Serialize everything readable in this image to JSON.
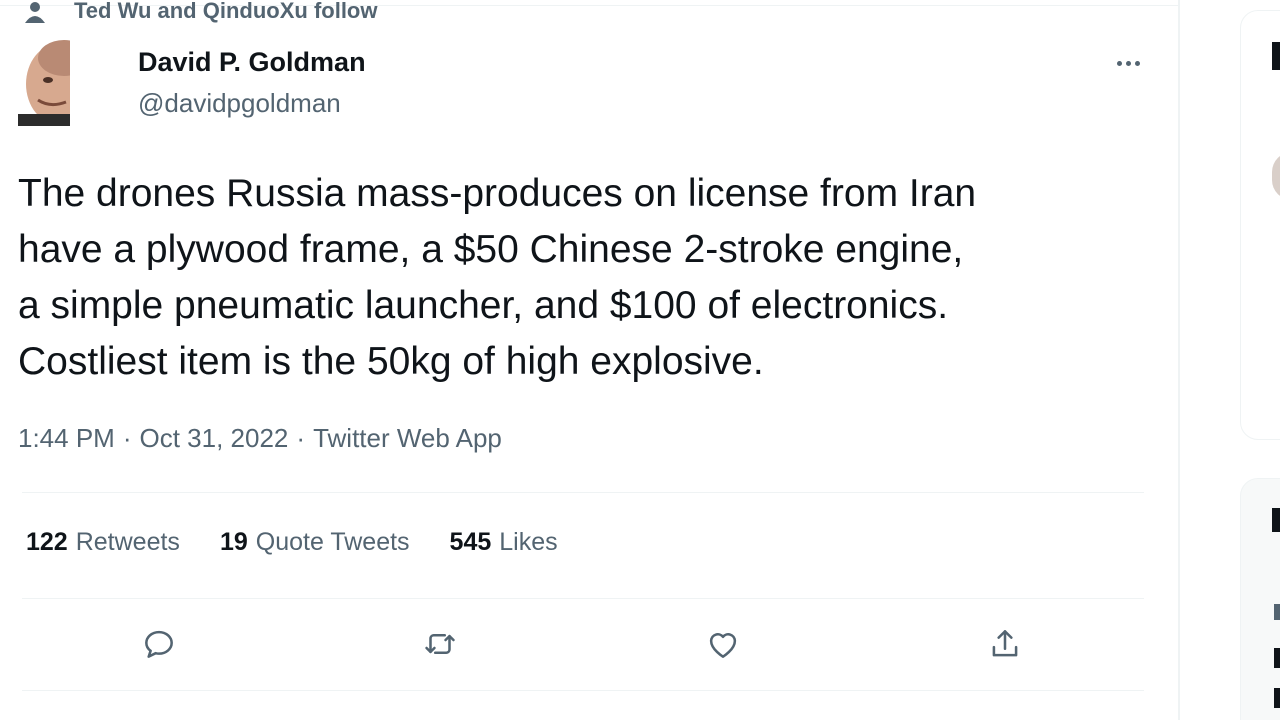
{
  "context": {
    "text": "Ted Wu and QinduoXu follow",
    "icon": "person-icon"
  },
  "author": {
    "name": "David P. Goldman",
    "handle": "@davidpgoldman"
  },
  "tweet": {
    "lines": [
      "The drones Russia mass-produces on license from Iran",
      "have a plywood frame, a $50 Chinese 2-stroke engine,",
      "a simple pneumatic launcher, and $100 of electronics.",
      "Costliest item is the 50kg of high explosive."
    ],
    "time": "1:44 PM",
    "date": "Oct 31, 2022",
    "source": "Twitter Web App",
    "separator": "·"
  },
  "stats": {
    "retweets_count": "122",
    "retweets_label": "Retweets",
    "quotes_count": "19",
    "quotes_label": "Quote Tweets",
    "likes_count": "545",
    "likes_label": "Likes"
  },
  "actions": [
    "reply-icon",
    "retweet-icon",
    "like-icon",
    "share-icon"
  ],
  "colors": {
    "text": "#0f1419",
    "secondary": "#536471",
    "border": "#eff3f4"
  }
}
